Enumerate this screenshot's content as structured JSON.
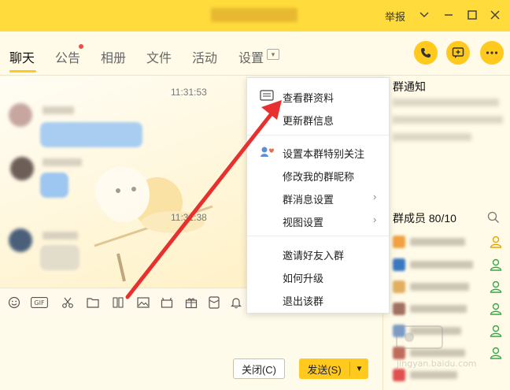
{
  "window": {
    "report": "举报"
  },
  "tabs": [
    {
      "label": "聊天"
    },
    {
      "label": "公告"
    },
    {
      "label": "相册"
    },
    {
      "label": "文件"
    },
    {
      "label": "活动"
    },
    {
      "label": "设置"
    }
  ],
  "chat": {
    "time1": "11:31:53",
    "time2": "11:31:38"
  },
  "buttons": {
    "close": "关闭(C)",
    "send": "发送(S)"
  },
  "right_panel": {
    "notice_title": "群通知",
    "members_title": "群成员 80/10"
  },
  "menu": {
    "items": [
      {
        "label": "查看群资料",
        "icon": "id-card-icon"
      },
      {
        "label": "更新群信息"
      },
      {
        "label": "设置本群特别关注",
        "icon": "special-care-icon"
      },
      {
        "label": "修改我的群昵称"
      },
      {
        "label": "群消息设置",
        "submenu": true
      },
      {
        "label": "视图设置",
        "submenu": true
      },
      {
        "label": "邀请好友入群"
      },
      {
        "label": "如何升级"
      },
      {
        "label": "退出该群"
      }
    ]
  },
  "watermark": {
    "text": "jingyan.baidu.com"
  },
  "colors": {
    "accent": "#ffc91e",
    "title_bar": "#ffdc3c",
    "annotation_arrow": "#e8312f"
  }
}
